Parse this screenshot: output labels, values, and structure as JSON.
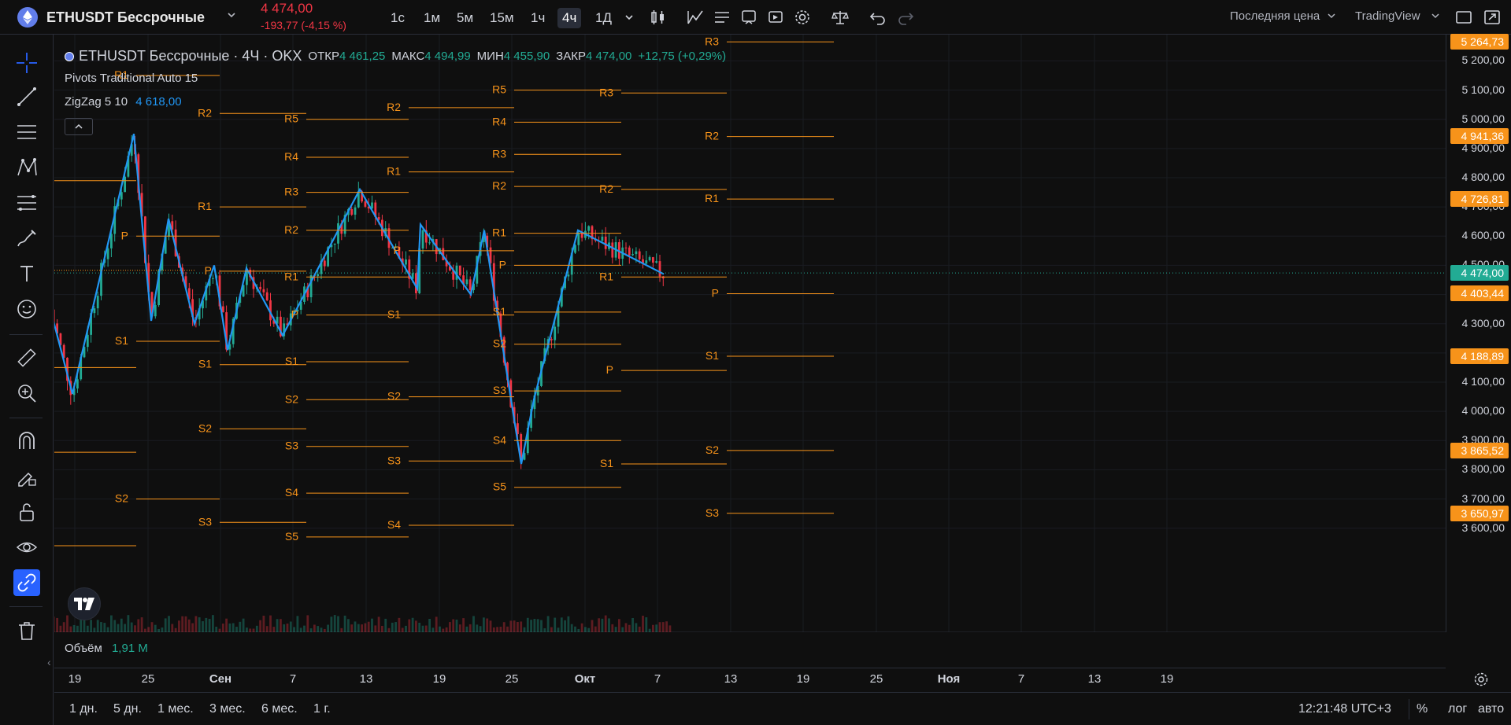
{
  "header": {
    "symbol": "ETHUSDT Бессрочные",
    "price": "4 474,00",
    "change": "-193,77 (-4,15 %)",
    "timeframes": [
      "1с",
      "1м",
      "5м",
      "15м",
      "1ч",
      "4ч",
      "1Д"
    ],
    "active_timeframe": "4ч",
    "price_source": "Последняя цена",
    "broker": "TradingView"
  },
  "legend": {
    "title": "ETHUSDT Бессрочные · 4Ч · OKX",
    "open_label": "ОТКР",
    "open": "4 461,25",
    "high_label": "МАКС",
    "high": "4 494,99",
    "low_label": "МИН",
    "low": "4 455,90",
    "close_label": "ЗАКР",
    "close": "4 474,00",
    "change": "+12,75 (+0,29%)",
    "indicator1": "Pivots Traditional Auto 15",
    "indicator2_name": "ZigZag 5 10",
    "indicator2_value": "4 618,00"
  },
  "volume": {
    "label": "Объём",
    "value": "1,91 M"
  },
  "price_scale": {
    "ticks": [
      "5 200,00",
      "5 100,00",
      "5 000,00",
      "4 900,00",
      "4 800,00",
      "4 700,00",
      "4 600,00",
      "4 500,00",
      "4 300,00",
      "4 100,00",
      "4 000,00",
      "3 900,00",
      "3 800,00",
      "3 700,00",
      "3 600,00"
    ],
    "badges": [
      {
        "text": "5 264,73",
        "color": "#f7931a"
      },
      {
        "text": "4 941,36",
        "color": "#f7931a"
      },
      {
        "text": "4 726,81",
        "color": "#f7931a"
      },
      {
        "text": "4 474,00",
        "color": "#22ab94"
      },
      {
        "text": "4 403,44",
        "color": "#f7931a"
      },
      {
        "text": "4 188,89",
        "color": "#f7931a"
      },
      {
        "text": "3 865,52",
        "color": "#f7931a"
      },
      {
        "text": "3 650,97",
        "color": "#f7931a"
      }
    ]
  },
  "time_axis": [
    "19",
    "25",
    "Сен",
    "7",
    "13",
    "19",
    "25",
    "Окт",
    "7",
    "13",
    "19",
    "25",
    "Ноя",
    "7",
    "13",
    "19"
  ],
  "bottom": {
    "ranges": [
      "1 дн.",
      "5 дн.",
      "1 мес.",
      "3 мес.",
      "6 мес.",
      "1 г."
    ],
    "clock": "12:21:48 UTC+3",
    "percent": "%",
    "log": "лог",
    "auto": "авто"
  },
  "pivot_labels": [
    "R1",
    "R2",
    "R3",
    "R4",
    "R5",
    "P",
    "S1",
    "S2",
    "S3",
    "S4",
    "S5"
  ],
  "colors": {
    "pivot": "#f7931a",
    "zigzag": "#2196f3",
    "up": "#22ab94",
    "down": "#f23645",
    "accent": "#2962ff"
  },
  "chart_data": {
    "type": "candlestick",
    "title": "ETHUSDT Бессрочные · 4Ч · OKX",
    "ylim": [
      3540,
      5290
    ],
    "zigzag": [
      4370,
      4060,
      4950,
      4310,
      4660,
      4300,
      4500,
      4210,
      4490,
      4260,
      4760,
      4420,
      4640,
      4400,
      4620,
      3820,
      4040,
      4620,
      4470
    ]
  }
}
